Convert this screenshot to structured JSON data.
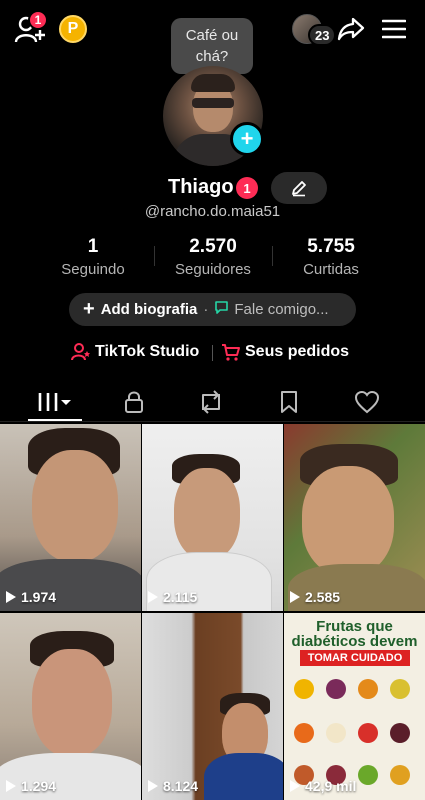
{
  "topbar": {
    "add_friends_badge": "1",
    "coin_label": "P",
    "story_count": "23"
  },
  "tooltip": {
    "line1": "Café ou",
    "line2": "chá?"
  },
  "profile": {
    "name": "Thiago",
    "name_badge": "1",
    "handle": "@rancho.do.maia51"
  },
  "stats": [
    {
      "value": "1",
      "label": "Seguindo"
    },
    {
      "value": "2.570",
      "label": "Seguidores"
    },
    {
      "value": "5.755",
      "label": "Curtidas"
    }
  ],
  "bio": {
    "add_label": "Add biografia",
    "separator": "·",
    "fale_label": "Fale comigo..."
  },
  "links": {
    "studio_label": "TikTok Studio",
    "orders_label": "Seus pedidos"
  },
  "videos": [
    {
      "views": "1.974"
    },
    {
      "views": "2.115"
    },
    {
      "views": "2.585"
    },
    {
      "views": "1.294"
    },
    {
      "views": "8.124"
    },
    {
      "views": "42,9 mil"
    }
  ],
  "infographic": {
    "title_line1": "Frutas que",
    "title_line2": "diabéticos devem",
    "pill": "TOMAR CUIDADO"
  },
  "colors": {
    "background": "#000000",
    "accent_red": "#fe2c55",
    "accent_cyan": "#20d5ec",
    "coin": "#f5b300",
    "chip_bg": "#2a2a2a"
  },
  "icons": [
    "add-friend-icon",
    "coin-icon",
    "share-icon",
    "menu-icon",
    "edit-icon",
    "plus-icon",
    "chat-icon",
    "studio-icon",
    "cart-icon",
    "grid-icon",
    "lock-icon",
    "repost-icon",
    "bookmark-icon",
    "heart-icon",
    "play-icon"
  ]
}
